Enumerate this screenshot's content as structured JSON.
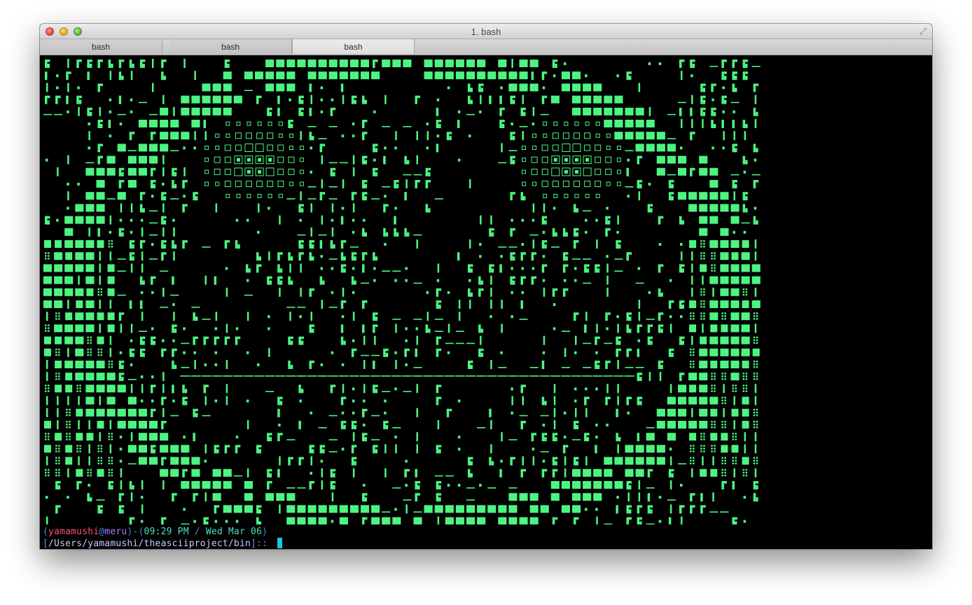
{
  "window": {
    "title": "1. bash"
  },
  "tabs": [
    {
      "label": "bash",
      "active": false
    },
    {
      "label": "bash",
      "active": false
    },
    {
      "label": "bash",
      "active": true
    }
  ],
  "colors": {
    "ascii_green": "#4cf582",
    "terminal_bg": "#000000",
    "user": "#ff4f7b",
    "host": "#b07cff",
    "time": "#45e2c4",
    "cursor": "#19c4dc"
  },
  "prompt": {
    "user": "yamamushi",
    "at": "@",
    "host": "meru",
    "time": "09:29 PM",
    "date": "Wed Mar 06",
    "path": "/Users/yamamushi/theasciiproject/bin",
    "suffix": ":: "
  },
  "art": {
    "icon": "ascii-art-mandala",
    "columns": 68,
    "rows": 39
  }
}
